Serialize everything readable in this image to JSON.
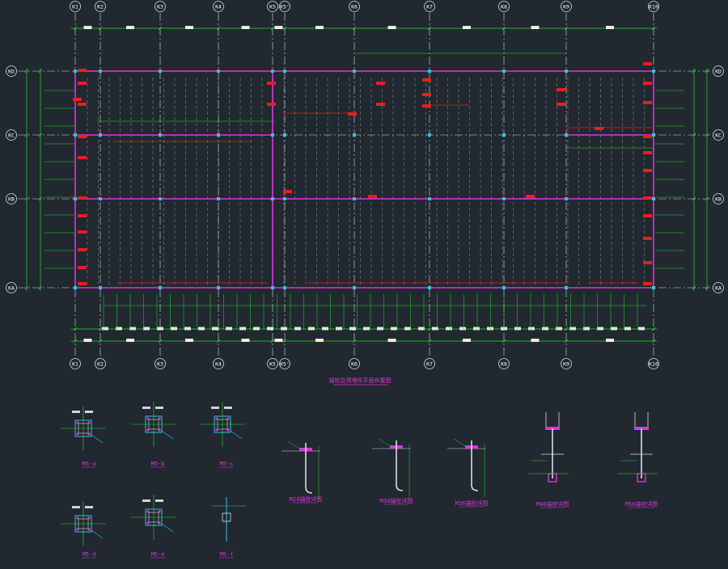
{
  "colors": {
    "background": "#212830",
    "grid_line": "#d8dde2",
    "dimension": "#22dd22",
    "beam": "#dd33dd",
    "tag": "#ee1c1c",
    "column": "#29c6e0",
    "text": "#ffffff"
  },
  "axes": {
    "columns": [
      {
        "label": "K1"
      },
      {
        "label": "K2"
      },
      {
        "label": "K3"
      },
      {
        "label": "K4"
      },
      {
        "label": "K5"
      },
      {
        "label": "K5'"
      },
      {
        "label": "K6"
      },
      {
        "label": "K7"
      },
      {
        "label": "K8"
      },
      {
        "label": "K9"
      },
      {
        "label": "K10"
      }
    ],
    "rows": [
      {
        "label": "KD"
      },
      {
        "label": "KC"
      },
      {
        "label": "KB"
      },
      {
        "label": "KA"
      }
    ]
  },
  "plan": {
    "title": "锚栓及预埋件平面布置图"
  },
  "details": [
    {
      "label": "M5-a"
    },
    {
      "label": "M5-b"
    },
    {
      "label": "M5-c"
    },
    {
      "label": "M5-d"
    },
    {
      "label": "M5-e"
    },
    {
      "label": "M5-f"
    },
    {
      "label": "M24锚栓详图"
    },
    {
      "label": "M30锚栓详图"
    },
    {
      "label": "M36锚栓详图"
    },
    {
      "label": "M48锚栓详图"
    },
    {
      "label": "M56锚栓详图"
    }
  ]
}
